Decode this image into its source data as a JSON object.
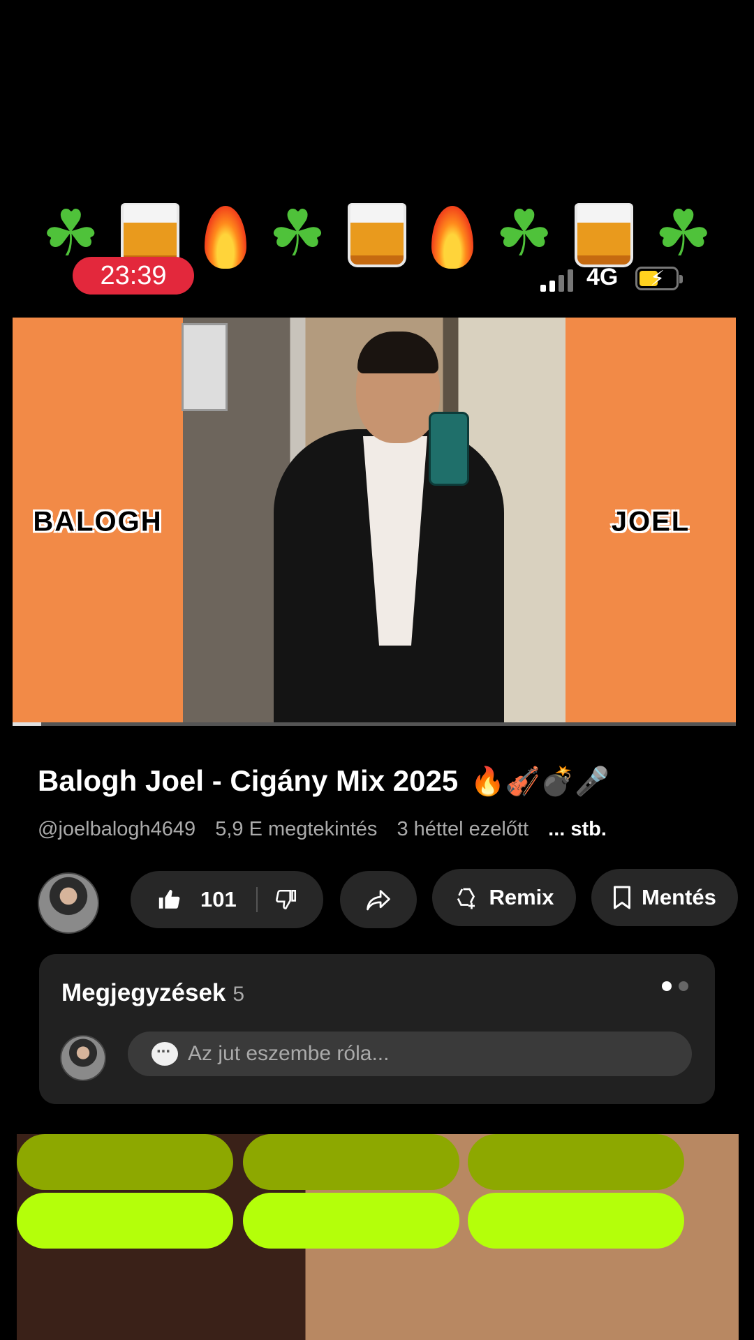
{
  "status": {
    "time": "23:39",
    "network": "4G"
  },
  "banner": {
    "emoji_sequence": [
      "shamrock",
      "whisky-glass",
      "fire",
      "shamrock",
      "whisky-glass",
      "fire",
      "shamrock",
      "whisky-glass",
      "shamrock"
    ]
  },
  "video": {
    "left_panel_text": "BALOGH",
    "right_panel_text": "JOEL",
    "panel_color": "#f28a47",
    "progress_fraction": 0.04
  },
  "details": {
    "title": "Balogh Joel - Cigány Mix 2025",
    "title_emojis": "🔥🎻💣🎤",
    "channel_handle": "@joelbalogh4649",
    "views": "5,9 E megtekintés",
    "age": "3 héttel ezelőtt",
    "more": "... stb."
  },
  "actions": {
    "like_count": "101",
    "remix_label": "Remix",
    "save_label": "Mentés"
  },
  "comments": {
    "title": "Megjegyzések",
    "count": "5",
    "placeholder": "Az jut eszembe róla..."
  },
  "preview": {
    "bar_color_top": "#8da800",
    "bar_color_bottom": "#b4ff0a"
  }
}
